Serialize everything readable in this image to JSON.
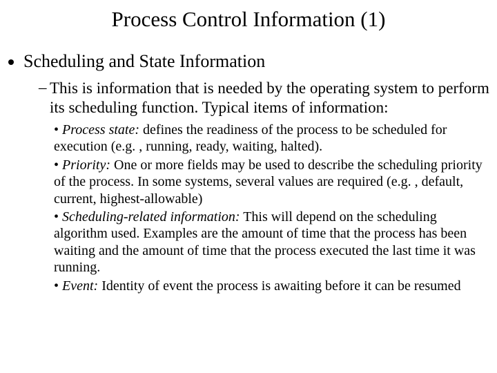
{
  "title": "Process Control Information (1)",
  "heading": "Scheduling and State Information",
  "intro": "This is information that is needed by the operating system to perform its scheduling function. Typical items of information:",
  "items": [
    {
      "term": "Process state:",
      "desc": " defines the readiness of the process to be scheduled for execution (e.g. , running, ready, waiting, halted)."
    },
    {
      "term": "Priority:",
      "desc": " One or more fields may be used to describe the scheduling priority of the process. In some systems, several values are required (e.g. , default, current, highest-allowable)"
    },
    {
      "term": "Scheduling-related information:",
      "desc": " This will depend on the scheduling algorithm used. Examples are the amount of time that the process has been waiting and the amount of time that the process executed the last time it was running."
    },
    {
      "term": "Event:",
      "desc": " Identity of event the process is awaiting before it can be resumed"
    }
  ],
  "bullet": "• ",
  "dash": "–"
}
